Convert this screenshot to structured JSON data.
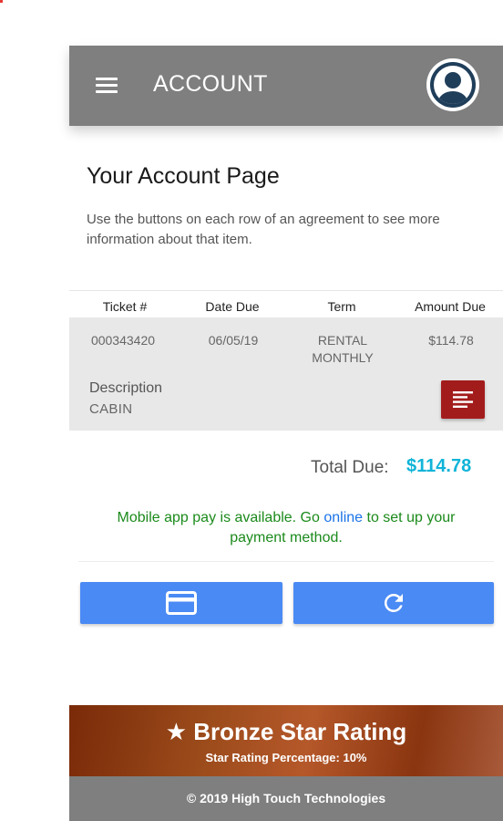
{
  "header": {
    "title": "ACCOUNT",
    "menu_icon": "hamburger-icon",
    "avatar_icon": "user-avatar-icon"
  },
  "intro": {
    "title": "Your Account Page",
    "description": "Use the buttons on each row of an agreement to see more information about that item."
  },
  "table": {
    "columns": [
      "Ticket #",
      "Date Due",
      "Term",
      "Amount Due"
    ],
    "rows": [
      {
        "ticket": "000343420",
        "date_due": "06/05/19",
        "term_line1": "RENTAL",
        "term_line2": "MONTHLY",
        "amount_due": "$114.78",
        "description_label": "Description",
        "description_value": "CABIN",
        "detail_icon": "details-list-icon"
      }
    ]
  },
  "totals": {
    "label": "Total Due:",
    "value": "$114.78"
  },
  "payment_message": {
    "before": "Mobile app pay is available. Go ",
    "link": "online",
    "after": " to set up your payment method."
  },
  "actions": {
    "pay_icon": "credit-card-icon",
    "refresh_icon": "refresh-icon"
  },
  "rating": {
    "title": "★ Bronze Star Rating",
    "subtitle": "Star Rating Percentage: 10%"
  },
  "footer": {
    "text": "© 2019 High Touch Technologies"
  },
  "colors": {
    "header": "#7f7f7f",
    "accent_blue": "#4a8af4",
    "detail_red": "#a31c1c",
    "total_cyan": "#10b4d8",
    "message_green": "#1b8a1b"
  }
}
